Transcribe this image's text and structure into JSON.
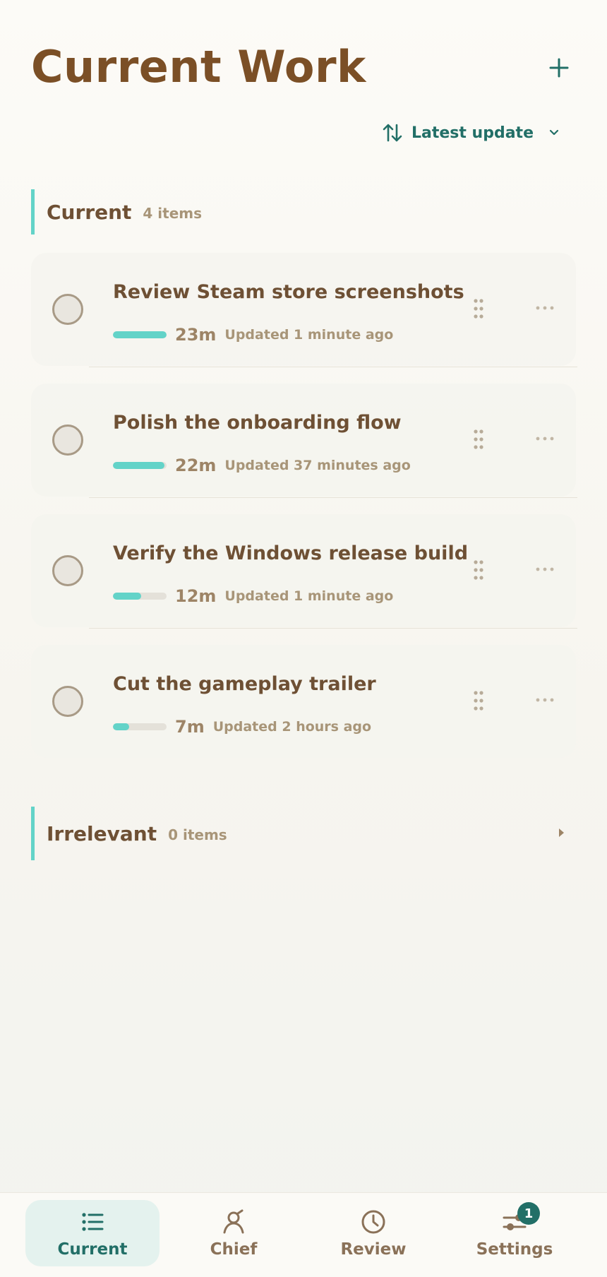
{
  "header": {
    "title": "Current Work",
    "add_icon": "plus-icon"
  },
  "sort": {
    "icon": "sort-arrows-icon",
    "label": "Latest update",
    "chevron": "chevron-down-icon"
  },
  "sections": [
    {
      "title": "Current",
      "count": "4 items",
      "tasks": [
        {
          "title": "Review Steam store screenshots",
          "duration": "23m",
          "updated": "Updated 1 minute ago",
          "progress": 1.0
        },
        {
          "title": "Polish the onboarding flow",
          "duration": "22m",
          "updated": "Updated 37 minutes ago",
          "progress": 0.96
        },
        {
          "title": "Verify the Windows release build",
          "duration": "12m",
          "updated": "Updated 1 minute ago",
          "progress": 0.52
        },
        {
          "title": "Cut the gameplay trailer",
          "duration": "7m",
          "updated": "Updated 2 hours ago",
          "progress": 0.3
        }
      ]
    },
    {
      "title": "Irrelevant",
      "count": "0 items",
      "collapsed": true
    }
  ],
  "colors": {
    "accent": "#63d3c8",
    "primary": "#226f67",
    "title": "#7b4f26"
  },
  "nav": {
    "items": [
      {
        "label": "Current",
        "icon": "list-icon",
        "active": true
      },
      {
        "label": "Chief",
        "icon": "person-icon",
        "active": false
      },
      {
        "label": "Review",
        "icon": "clock-icon",
        "active": false
      },
      {
        "label": "Settings",
        "icon": "sliders-icon",
        "active": false,
        "badge": "1"
      }
    ]
  }
}
